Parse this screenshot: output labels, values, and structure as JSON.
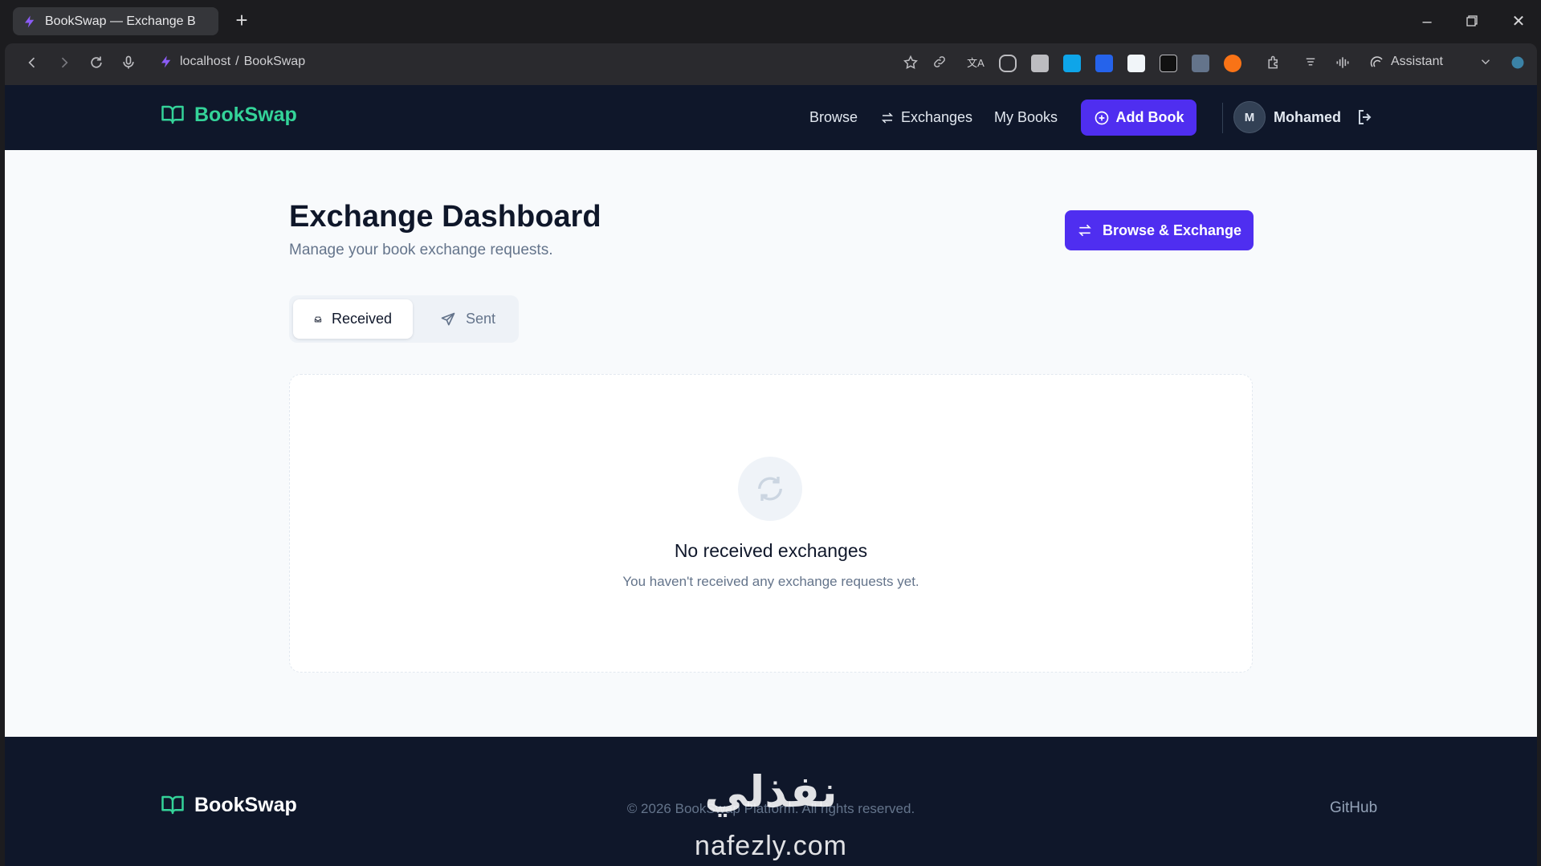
{
  "browser": {
    "tab_title": "BookSwap — Exchange B",
    "url_host": "localhost",
    "url_separator": "/",
    "url_page": "BookSwap",
    "assistant_label": "Assistant"
  },
  "navbar": {
    "brand": "BookSwap",
    "links": [
      {
        "label": "Browse"
      },
      {
        "label": "Exchanges"
      },
      {
        "label": "My Books"
      }
    ],
    "add_book_label": "Add Book",
    "user_initial": "M",
    "user_name": "Mohamed"
  },
  "header": {
    "title": "Exchange Dashboard",
    "subtitle": "Manage your book exchange requests.",
    "browse_button": "Browse & Exchange"
  },
  "tabs": [
    {
      "label": "Received",
      "active": true
    },
    {
      "label": "Sent",
      "active": false
    }
  ],
  "empty_state": {
    "title": "No received exchanges",
    "text": "You haven't received any exchange requests yet."
  },
  "footer": {
    "brand": "BookSwap",
    "copyright": "© 2026 BookSwap Platform. All rights reserved.",
    "link": "GitHub"
  },
  "watermark": {
    "arabic": "نفذلي",
    "latin": "nafezly.com"
  },
  "colors": {
    "accent": "#4f2ef0",
    "brand_green": "#34d399",
    "navbar_bg": "#0f172a"
  }
}
